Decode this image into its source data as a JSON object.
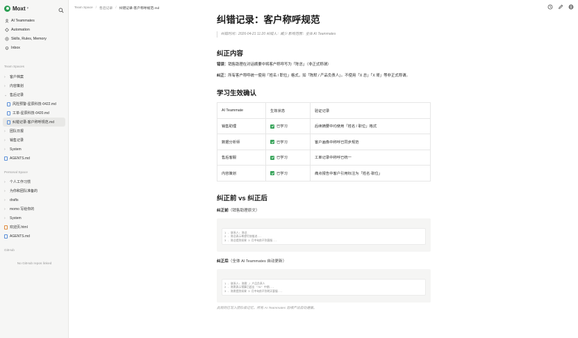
{
  "app": {
    "name": "Moxt"
  },
  "nav": [
    {
      "label": "AI Teammates",
      "icon": "people-icon"
    },
    {
      "label": "Automation",
      "icon": "automation-icon"
    },
    {
      "label": "Skills, Rules, Memory",
      "icon": "skills-icon"
    },
    {
      "label": "Inbox",
      "icon": "inbox-icon"
    }
  ],
  "team_spaces": {
    "label": "Team Spaces",
    "items": [
      {
        "label": "客户档案",
        "type": "folder",
        "expanded": false
      },
      {
        "label": "内容策划",
        "type": "folder",
        "expanded": false
      },
      {
        "label": "售后记录",
        "type": "folder",
        "expanded": true
      },
      {
        "label": "风险预警-星辰科技-0422.md",
        "type": "file",
        "sub": true
      },
      {
        "label": "工单-星辰科技-0420.md",
        "type": "file",
        "sub": true
      },
      {
        "label": "纠错记录-客户称呼规范.md",
        "type": "file",
        "sub": true,
        "active": true
      },
      {
        "label": "团队日报",
        "type": "folder",
        "expanded": false
      },
      {
        "label": "销售记录",
        "type": "folder",
        "expanded": false
      },
      {
        "label": "System",
        "type": "folder",
        "expanded": false
      },
      {
        "label": "AGENTS.md",
        "type": "file",
        "sub": false
      }
    ]
  },
  "personal_space": {
    "label": "Personal Space",
    "items": [
      {
        "label": "个人工作习惯",
        "type": "folder"
      },
      {
        "label": "为你和团队准备的",
        "type": "folder"
      },
      {
        "label": "drafts",
        "type": "folder"
      },
      {
        "label": "momo 写给你的",
        "type": "folder"
      },
      {
        "label": "System",
        "type": "folder"
      },
      {
        "label": "欢迎页.html",
        "type": "html"
      },
      {
        "label": "AGENTS.md",
        "type": "file"
      }
    ]
  },
  "github": {
    "label": "GitHub",
    "empty": "No GitHub repos linked"
  },
  "breadcrumb": [
    "Team Space",
    "售后记录",
    "纠错记录-客户称呼规范.md"
  ],
  "doc": {
    "title": "纠错记录：客户称呼规范",
    "meta": "纠错时间：2026-04-21 11:20  纠错人：臧少  影响范围：全体 AI Teammates",
    "section1": {
      "heading": "纠正内容",
      "p1_label": "错误：",
      "p1_text": "销售助理在对话摘要中将客户称呼写为「陈总」（非正式称谓）",
      "p2_label": "纠正：",
      "p2_text": "所有客户称呼统一使用「姓名 / 职位」格式，如「陈默 / 产品负责人」。不使用「X 总」「X 哥」等非正式称谓。"
    },
    "section2": {
      "heading": "学习生效确认",
      "headers": [
        "AI Teammate",
        "生效状态",
        "验证记录"
      ],
      "rows": [
        [
          "销售助理",
          "已学习",
          "后续摘要中均使用「姓名 / 职位」格式"
        ],
        [
          "数据分析师",
          "已学习",
          "客户画像中称呼已同步规范"
        ],
        [
          "售后客服",
          "已学习",
          "工单记录中称呼已统一"
        ],
        [
          "内容策划",
          "已学习",
          "痛点报告中客户引用标注为「姓名·职位」"
        ]
      ]
    },
    "section3": {
      "heading": "纠正前 vs 纠正后",
      "before_label": "纠正前",
      "before_note": "（销售助理原文）",
      "before_lines": [
        "1  - 联系人: 陈总",
        "2  - 陈总表示希望尽快推进...",
        "3  - 陈总提到如果 3 月中旬前不到客服..."
      ],
      "after_label": "纠正后",
      "after_note": "（全体 AI Teammates 自动更新）",
      "after_lines": [
        "1  - 联系人: 陈默 / 产品负责人",
        "2  - 陈默表示预算已超出 \"70\" 中期...",
        "3  - 陈默提到如果 3 月中旬前不到明天客服..."
      ],
      "footnote": "此规则已写入团队级记忆，所有 AI Teammates 后续产出自动遵循。"
    }
  },
  "colors": {
    "accent": "#2a9d52",
    "check": "#3aa55c"
  }
}
